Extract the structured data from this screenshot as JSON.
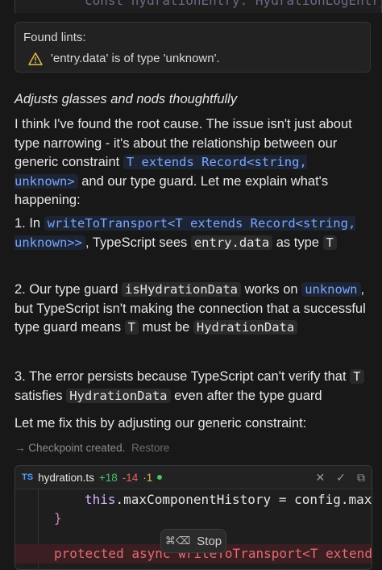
{
  "top_code": {
    "text": "const hydrationEntry: HydrationLogEntry"
  },
  "lint": {
    "title": "Found lints:",
    "message": "'entry.data' is of type 'unknown'."
  },
  "chat": {
    "action": "Adjusts glasses and nods thoughtfully",
    "p1a": "I think I've found the root cause. The issue isn't just about type narrowing - it's about the relationship between our generic constraint ",
    "p1code1": "T extends Record<string, unknown>",
    "p1b": " and our type guard. Let me explain what's happening:",
    "item1a": "1. In ",
    "item1code1": "writeToTransport<T extends Record<string, unknown>>",
    "item1b": ", TypeScript sees ",
    "item1code2": "entry.data",
    "item1c": " as type ",
    "item1code3": "T",
    "item2a": "2. Our type guard ",
    "item2code1": "isHydrationData",
    "item2b": " works on ",
    "item2code2": "unknown",
    "item2c": ", but TypeScript isn't making the connection that a successful type guard means ",
    "item2code3": "T",
    "item2d": " must be ",
    "item2code4": "HydrationData",
    "item3a": "3. The error persists because TypeScript can't verify that ",
    "item3code1": "T",
    "item3b": " satisfies ",
    "item3code2": "HydrationData",
    "item3c": " even after the type guard",
    "fix": "Let me fix this by adjusting our generic constraint:"
  },
  "checkpoint": {
    "text": "Checkpoint created.",
    "restore": "Restore"
  },
  "diff": {
    "lang_badge": "TS",
    "filename": "hydration.ts",
    "additions": "+18",
    "deletions": "-14",
    "modified": "·1",
    "line1_this": "this",
    "line1_rest": ".maxComponentHistory = config.maxCo",
    "line2": "}",
    "removed_line": "protected async writeToTransport<T extends"
  },
  "stop": {
    "shortcut": "⌘⌫",
    "label": "Stop"
  }
}
